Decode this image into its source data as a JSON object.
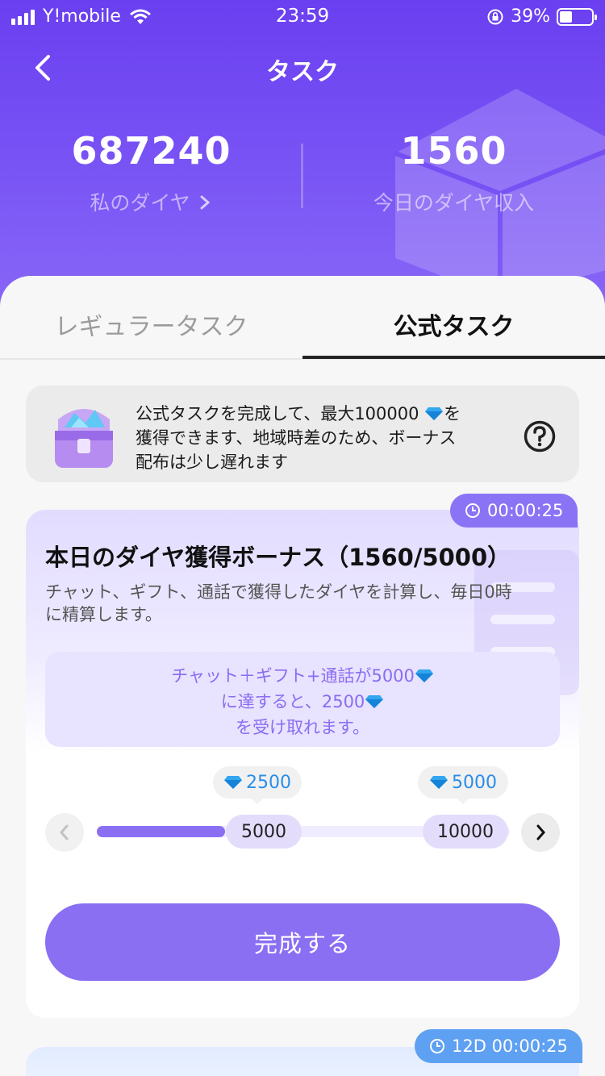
{
  "status_bar": {
    "carrier": "Y!mobile",
    "time": "23:59",
    "battery": "39%",
    "battery_level": 0.39
  },
  "header": {
    "title": "タスク",
    "my_diamonds_value": "687240",
    "my_diamonds_label": "私のダイヤ",
    "today_income_value": "1560",
    "today_income_label": "今日のダイヤ収入"
  },
  "tabs": [
    {
      "label": "レギュラータスク"
    },
    {
      "label": "公式タスク"
    }
  ],
  "info_banner": {
    "line1_a": "公式タスクを完成して、最大100000",
    "line1_b": "を",
    "line2": "獲得できます、地域時差のため、ボーナス",
    "line3": "配布は少し遅れます"
  },
  "task_card": {
    "timer": "00:00:25",
    "title": "本日のダイヤ獲得ボーナス（1560/5000）",
    "description_l1": "チャット、ギフト、通話で獲得したダイヤを計算し、毎日0時",
    "description_l2": "に精算します。",
    "condition_l1": "チャット＋ギフト+通話が5000",
    "condition_l2": "に達すると、2500",
    "condition_l3": "を受け取れます。",
    "rewards": [
      {
        "value": "2500"
      },
      {
        "value": "5000"
      }
    ],
    "milestones": [
      {
        "value": "5000"
      },
      {
        "value": "10000"
      }
    ],
    "progress_fraction": 0.31,
    "complete_label": "完成する"
  },
  "next_card": {
    "timer": "12D 00:00:25"
  },
  "colors": {
    "accent": "#8a6ff3",
    "header": "#6a3ff0",
    "diamond": "#2a8ee8",
    "timer_blue": "#5ea0f2"
  }
}
